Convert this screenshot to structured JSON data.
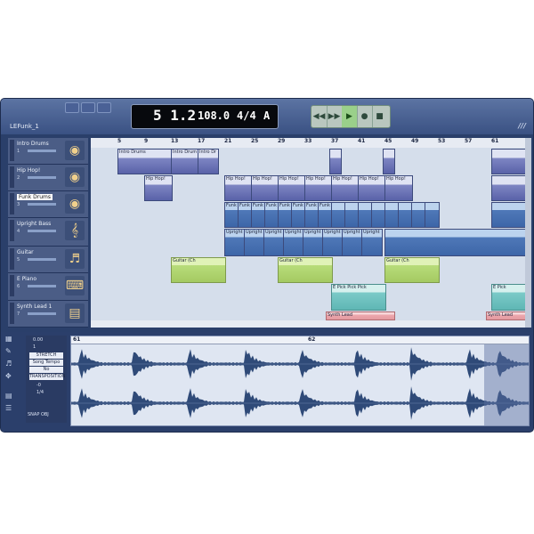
{
  "song": {
    "name": "LEFunk_1"
  },
  "transport": {
    "position": "5 1.2",
    "tempo": "108.0",
    "signature": "4/4",
    "key": "A",
    "icons": [
      "rewind-icon",
      "forward-icon",
      "play-icon",
      "record-icon",
      "stop-icon"
    ]
  },
  "ruler": {
    "bars": [
      "5",
      "9",
      "13",
      "17",
      "21",
      "25",
      "29",
      "33",
      "37",
      "41",
      "45",
      "49",
      "53",
      "57",
      "61"
    ]
  },
  "tracks": [
    {
      "name": "Intro Drums",
      "num": "1",
      "icon": "drumkit-icon"
    },
    {
      "name": "Hip Hop!",
      "num": "2",
      "icon": "drumkit-icon"
    },
    {
      "name": "Funk Drums",
      "num": "3",
      "icon": "drumkit-icon",
      "selected": true
    },
    {
      "name": "Upright Bass",
      "num": "4",
      "icon": "upright-bass-icon"
    },
    {
      "name": "Guitar",
      "num": "5",
      "icon": "guitar-icon"
    },
    {
      "name": "E Piano",
      "num": "6",
      "icon": "piano-icon"
    },
    {
      "name": "Synth Lead 1",
      "num": "7",
      "icon": "keyboard-icon"
    }
  ],
  "clips": {
    "intro": [
      "Intro Drums",
      "Intro Drum",
      "Intro Dr"
    ],
    "hiphop": [
      "Hip Hop!",
      "Hip Hop!",
      "Hip Hop!",
      "Hip Hop!",
      "Hip Hop!",
      "Hip Hop!",
      "Hip Hop!",
      "Hip Hop!"
    ],
    "funk": [
      "Funk",
      "Funk",
      "Funk",
      "Funk",
      "Funk",
      "Funk",
      "Funk",
      "Funk"
    ],
    "bass": [
      "Upright",
      "Upright",
      "Upright",
      "Upright",
      "Upright",
      "Upright",
      "Upright",
      "Upright"
    ],
    "guitar": [
      "Guitar (Ch",
      "Guitar (Ch",
      "Guitar (Ch"
    ],
    "epiano": [
      "E Pick Pick Pick",
      "E Pick"
    ],
    "synth": [
      "Synth Lead",
      "Synth Lead"
    ]
  },
  "editor": {
    "ruler": [
      "61",
      "62"
    ],
    "value1": "0.00",
    "value2": "1",
    "stretch_label": "STRETCH MODE",
    "song_tempo": "Song Tempo",
    "mode": "No",
    "transpose": "TRANSPOSITION",
    "val3": "-0",
    "val4": "1/4",
    "snap": "SNAP OBJ"
  }
}
